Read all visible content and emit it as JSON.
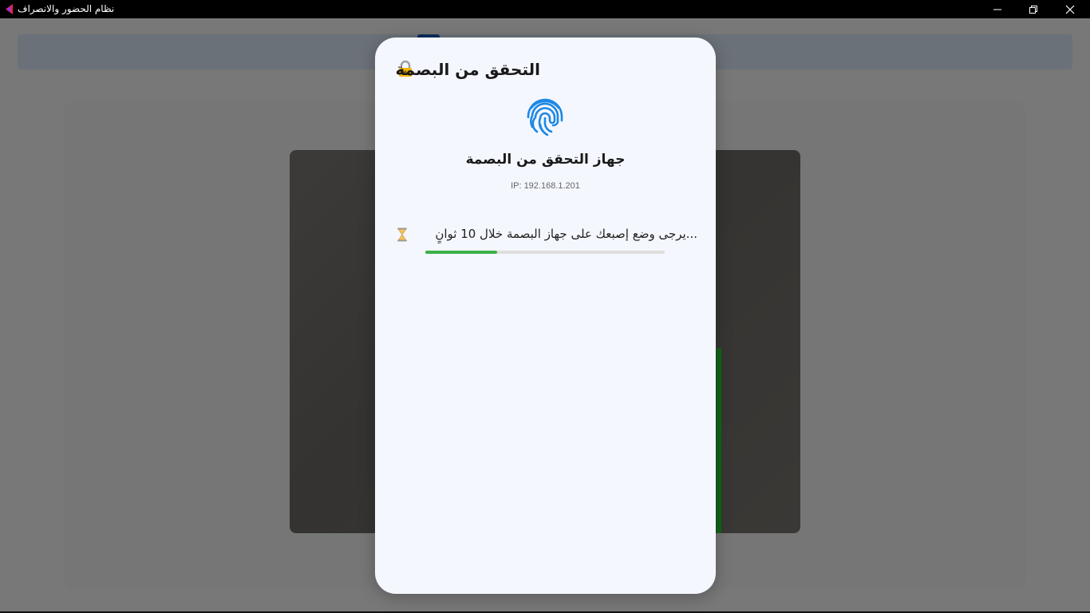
{
  "window": {
    "title": "نظام الحضور والانصراف",
    "logo_icon": "app-logo-icon",
    "controls": [
      "minimize-icon",
      "maximize-icon",
      "close-icon"
    ]
  },
  "dialog": {
    "title": "التحقق من البصمة",
    "title_icon": "lock-icon",
    "device_icon": "fingerprint-icon",
    "device_name": "جهاز التحقق من البصمة",
    "device_ip": "IP: 192.168.1.201",
    "status_icon": "hourglass-icon",
    "status_text": "...يرجى وضع إصبعك على جهاز البصمة خلال 10 ثوانٍ",
    "progress_percent": 30
  },
  "colors": {
    "accent": "#1e88e5",
    "progress": "#3cb04a",
    "titlebar": "#000000"
  }
}
